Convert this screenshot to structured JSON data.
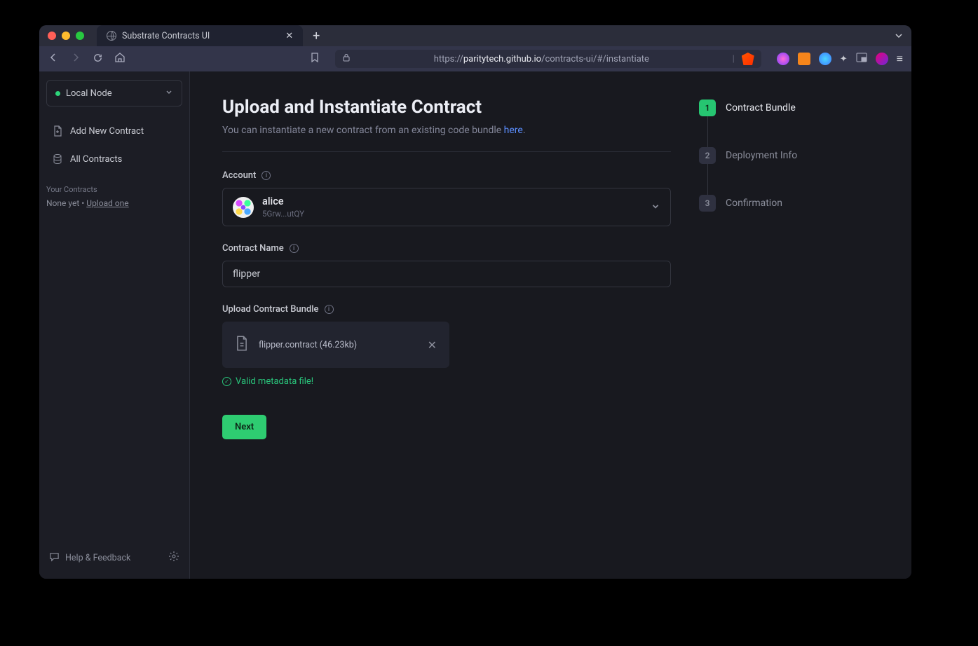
{
  "browser": {
    "tab_title": "Substrate Contracts UI",
    "url_pre": "https://",
    "url_bold": "paritytech.github.io",
    "url_rest": "/contracts-ui/#/instantiate"
  },
  "sidebar": {
    "node_label": "Local Node",
    "nav": {
      "add_new": "Add New Contract",
      "all": "All Contracts"
    },
    "your_contracts_title": "Your Contracts",
    "your_contracts_text_a": "None yet",
    "your_contracts_dot": "  •  ",
    "your_contracts_link": "Upload one",
    "help_feedback": "Help & Feedback"
  },
  "main": {
    "title": "Upload and Instantiate Contract",
    "subtitle_a": "You can instantiate a new contract from an existing code bundle ",
    "subtitle_link": "here",
    "subtitle_b": ".",
    "account_label": "Account",
    "account_name": "alice",
    "account_addr": "5Grw...utQY",
    "contract_name_label": "Contract Name",
    "contract_name_value": "flipper",
    "upload_label": "Upload Contract Bundle",
    "file_name": "flipper.contract (46.23kb)",
    "valid_msg": "Valid metadata file!",
    "next_label": "Next"
  },
  "steps": [
    {
      "num": "1",
      "label": "Contract Bundle"
    },
    {
      "num": "2",
      "label": "Deployment Info"
    },
    {
      "num": "3",
      "label": "Confirmation"
    }
  ]
}
